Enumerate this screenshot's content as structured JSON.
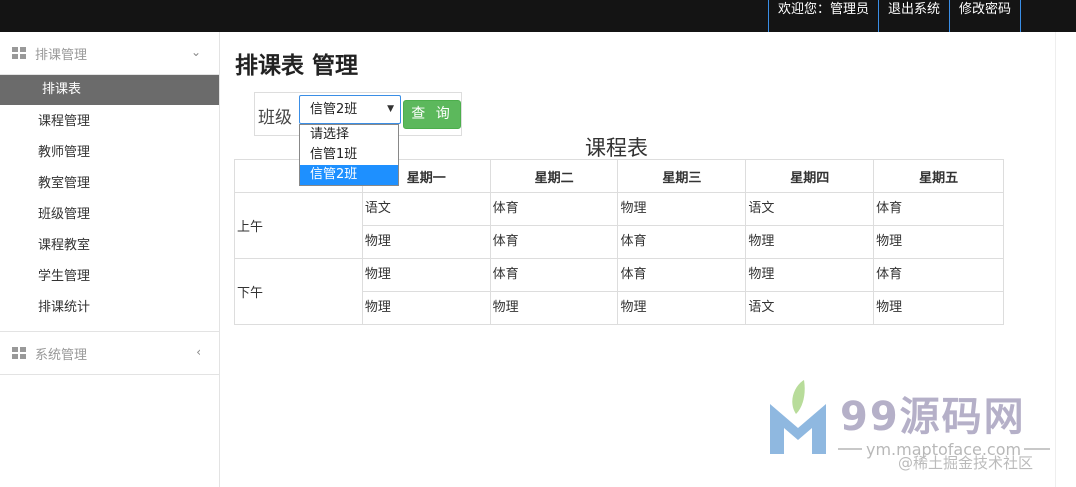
{
  "topnav": {
    "welcome": "欢迎您：管理员",
    "logout": "退出系统",
    "change_password": "修改密码"
  },
  "sidebar": {
    "group1": {
      "label": "排课管理",
      "icon": "grid-icon",
      "chevron": "chevron-down-icon"
    },
    "items": [
      {
        "label": "排课表",
        "active": true
      },
      {
        "label": "课程管理"
      },
      {
        "label": "教师管理"
      },
      {
        "label": "教室管理"
      },
      {
        "label": "班级管理"
      },
      {
        "label": "课程教室"
      },
      {
        "label": "学生管理"
      },
      {
        "label": "排课统计"
      }
    ],
    "group2": {
      "label": "系统管理",
      "icon": "grid-icon",
      "chevron": "chevron-left-icon"
    }
  },
  "main": {
    "page_title": "排课表 管理",
    "filter": {
      "label": "班级",
      "selected": "信管2班",
      "options": [
        "请选择",
        "信管1班",
        "信管2班"
      ],
      "query_button": "查 询"
    },
    "table_title": "课程表",
    "headers": [
      "",
      "星期一",
      "星期二",
      "星期三",
      "星期四",
      "星期五"
    ],
    "periods": [
      {
        "label": "上午",
        "rows": [
          [
            "语文",
            "体育",
            "物理",
            "语文",
            "体育"
          ],
          [
            "物理",
            "体育",
            "体育",
            "物理",
            "物理"
          ]
        ]
      },
      {
        "label": "下午",
        "rows": [
          [
            "物理",
            "体育",
            "体育",
            "物理",
            "体育"
          ],
          [
            "物理",
            "物理",
            "物理",
            "语文",
            "物理"
          ]
        ]
      }
    ]
  },
  "watermark": {
    "brand": "99源码网",
    "url": "ym.maptoface.com",
    "credit": "@稀土掘金技术社区"
  },
  "colors": {
    "topbar": "#141414",
    "active_item": "#6b6b6b",
    "query_button": "#5cb85c",
    "dropdown_selected": "#1e90ff"
  }
}
